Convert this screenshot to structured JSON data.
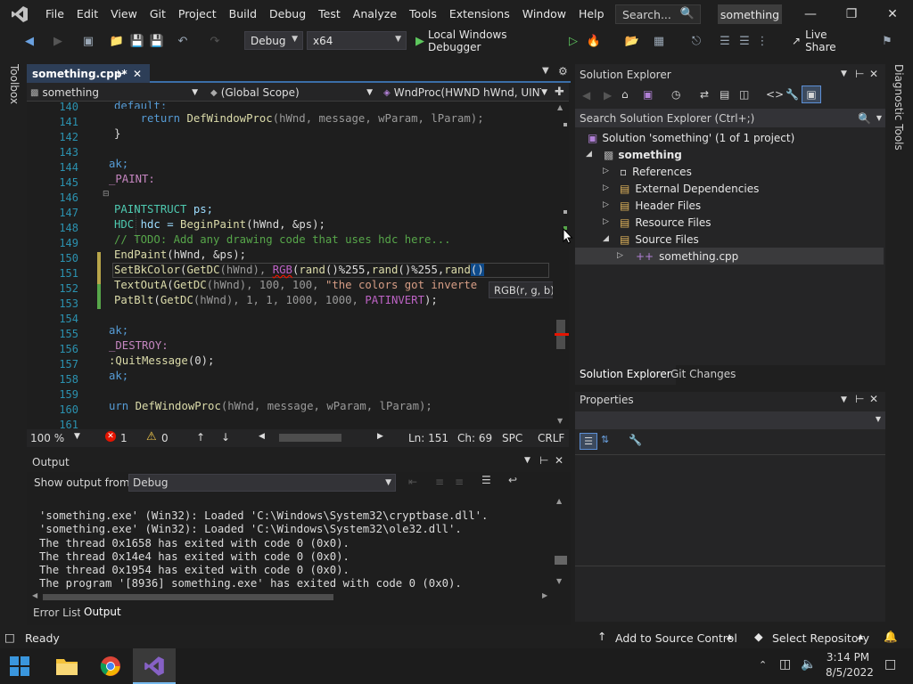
{
  "menu": [
    "File",
    "Edit",
    "View",
    "Git",
    "Project",
    "Build",
    "Debug",
    "Test",
    "Analyze",
    "Tools",
    "Extensions",
    "Window",
    "Help"
  ],
  "search": {
    "label": "Search..."
  },
  "project_badge": "something",
  "toolbar": {
    "config": "Debug",
    "platform": "x64",
    "run_label": "Local Windows Debugger",
    "live_share": "Live Share"
  },
  "left_strip": "Toolbox",
  "right_strip": "Diagnostic Tools",
  "editor": {
    "tab_title": "something.cpp*",
    "nav_project": "something",
    "nav_scope": "(Global Scope)",
    "nav_function": "WndProc(HWND hWnd, UINT",
    "line_numbers": [
      "140",
      "141",
      "142",
      "143",
      "144",
      "145",
      "146",
      "147",
      "148",
      "149",
      "150",
      "151",
      "152",
      "153",
      "154",
      "155",
      "156",
      "157",
      "158",
      "159",
      "160",
      "161"
    ],
    "tooltip": "RGB(r, g, b)",
    "zoom": "100 %",
    "errors": "1",
    "warnings": "0",
    "line": "Ln: 151",
    "col": "Ch: 69",
    "spc": "SPC",
    "eol": "CRLF"
  },
  "code_lines": {
    "l140": "default:",
    "l141a": "    return ",
    "l141b": "DefWindowProc",
    "l141c": "(hWnd, message, wParam, lParam);",
    "l142": "}",
    "l144": "ak;",
    "l145": "_PAINT:",
    "l147a": "PAINTSTRUCT ",
    "l147b": "ps;",
    "l148a": "HDC ",
    "l148b": "hdc = ",
    "l148c": "BeginPaint",
    "l148d": "(hWnd, &ps);",
    "l149": "// TODO: Add any drawing code that uses hdc here...",
    "l150a": "EndPaint",
    "l150b": "(hWnd, &ps);",
    "l151a": "SetBkColor",
    "l151b": "(",
    "l151c": "GetDC",
    "l151d": "(hWnd), ",
    "l151e": "RGB",
    "l151f": "(",
    "l151g": "rand",
    "l151h": "()%255,",
    "l151i": "rand",
    "l151j": "()%255,",
    "l151k": "rand",
    "l151l": "()",
    "l152a": "TextOutA",
    "l152b": "(",
    "l152c": "GetDC",
    "l152d": "(hWnd), 100, 100, ",
    "l152e": "\"the colors got inverte",
    "l153a": "PatBlt",
    "l153b": "(",
    "l153c": "GetDC",
    "l153d": "(hWnd), 1, 1, 1000, 1000, ",
    "l153e": "PATINVERT",
    "l153f": ");",
    "l155": "ak;",
    "l156": "_DESTROY:",
    "l157a": ":QuitMessage",
    "l157b": "(0);",
    "l158": "ak;",
    "l160a": "urn ",
    "l160b": "DefWindowProc",
    "l160c": "(hWnd, message, wParam, lParam);"
  },
  "output": {
    "title": "Output",
    "show_from_label": "Show output from:",
    "source": "Debug",
    "lines": [
      "'something.exe' (Win32): Loaded 'C:\\Windows\\System32\\cryptbase.dll'.",
      "'something.exe' (Win32): Loaded 'C:\\Windows\\System32\\ole32.dll'.",
      "The thread 0x1658 has exited with code 0 (0x0).",
      "The thread 0x14e4 has exited with code 0 (0x0).",
      "The thread 0x1954 has exited with code 0 (0x0).",
      "The program '[8936] something.exe' has exited with code 0 (0x0)."
    ],
    "tab_error_list": "Error List",
    "tab_output": "Output"
  },
  "solution_explorer": {
    "title": "Solution Explorer",
    "search_placeholder": "Search Solution Explorer (Ctrl+;)",
    "solution": "Solution 'something' (1 of 1 project)",
    "project": "something",
    "items": [
      "References",
      "External Dependencies",
      "Header Files",
      "Resource Files",
      "Source Files"
    ],
    "file": "something.cpp",
    "tab_solution": "Solution Explorer",
    "tab_git": "Git Changes"
  },
  "properties": {
    "title": "Properties"
  },
  "status": {
    "ready": "Ready",
    "source_control": "Add to Source Control",
    "repository": "Select Repository"
  },
  "taskbar": {
    "time": "3:14 PM",
    "date": "8/5/2022"
  },
  "colors": {
    "accent": "#3b6ea8",
    "vs_purple": "#8661c5",
    "green_run": "#5ec75e",
    "error_red": "#e51400"
  }
}
